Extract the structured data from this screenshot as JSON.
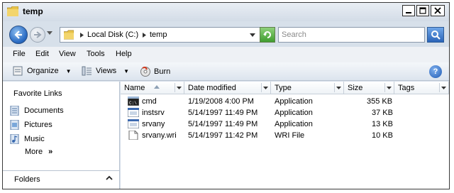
{
  "window": {
    "title": "temp",
    "controls": [
      "minimize",
      "maximize",
      "close"
    ]
  },
  "address": {
    "breadcrumbs": [
      "Local Disk (C:)",
      "temp"
    ]
  },
  "search": {
    "placeholder": "Search"
  },
  "menu": [
    "File",
    "Edit",
    "View",
    "Tools",
    "Help"
  ],
  "toolbar": {
    "organize": "Organize",
    "views": "Views",
    "burn": "Burn"
  },
  "nav": {
    "favorites_title": "Favorite Links",
    "items": [
      {
        "label": "Documents",
        "icon": "documents-icon"
      },
      {
        "label": "Pictures",
        "icon": "pictures-icon"
      },
      {
        "label": "Music",
        "icon": "music-icon"
      }
    ],
    "more": "More",
    "more_glyph": "»",
    "folders": "Folders"
  },
  "columns": [
    "Name",
    "Date modified",
    "Type",
    "Size",
    "Tags"
  ],
  "files": [
    {
      "name": "cmd",
      "date": "1/19/2008 4:00 PM",
      "type": "Application",
      "size": "355 KB",
      "icon": "cmd-icon"
    },
    {
      "name": "instsrv",
      "date": "5/14/1997 11:49 PM",
      "type": "Application",
      "size": "37 KB",
      "icon": "application-icon"
    },
    {
      "name": "srvany",
      "date": "5/14/1997 11:49 PM",
      "type": "Application",
      "size": "13 KB",
      "icon": "application-icon"
    },
    {
      "name": "srvany.wri",
      "date": "5/14/1997 11:42 PM",
      "type": "WRI File",
      "size": "10 KB",
      "icon": "file-icon"
    }
  ],
  "colors": {
    "accent": "#2b6cc4",
    "chrome": "#d7e0ea",
    "refresh": "#3f9d2f"
  }
}
